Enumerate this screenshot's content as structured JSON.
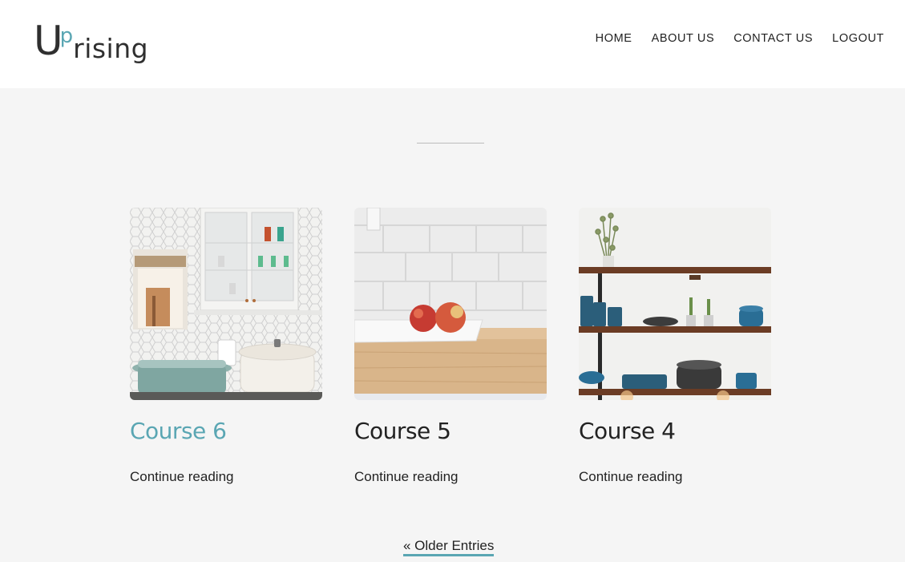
{
  "header": {
    "logo": {
      "u": "U",
      "p": "p",
      "rest": "rising"
    },
    "nav": [
      "HOME",
      "ABOUT US",
      "CONTACT US",
      "LOGOUT"
    ]
  },
  "posts": [
    {
      "title": "Course 6",
      "link": "Continue reading",
      "image": "kitchen-pots-cabinet-photo"
    },
    {
      "title": "Course 5",
      "link": "Continue reading",
      "image": "apples-on-counter-photo"
    },
    {
      "title": "Course 4",
      "link": "Continue reading",
      "image": "kitchen-shelves-photo"
    }
  ],
  "pagination": {
    "older": "« Older Entries"
  },
  "colors": {
    "accent": "#5aa6b3",
    "background": "#f5f5f5",
    "header": "#ffffff",
    "text": "#222222"
  }
}
